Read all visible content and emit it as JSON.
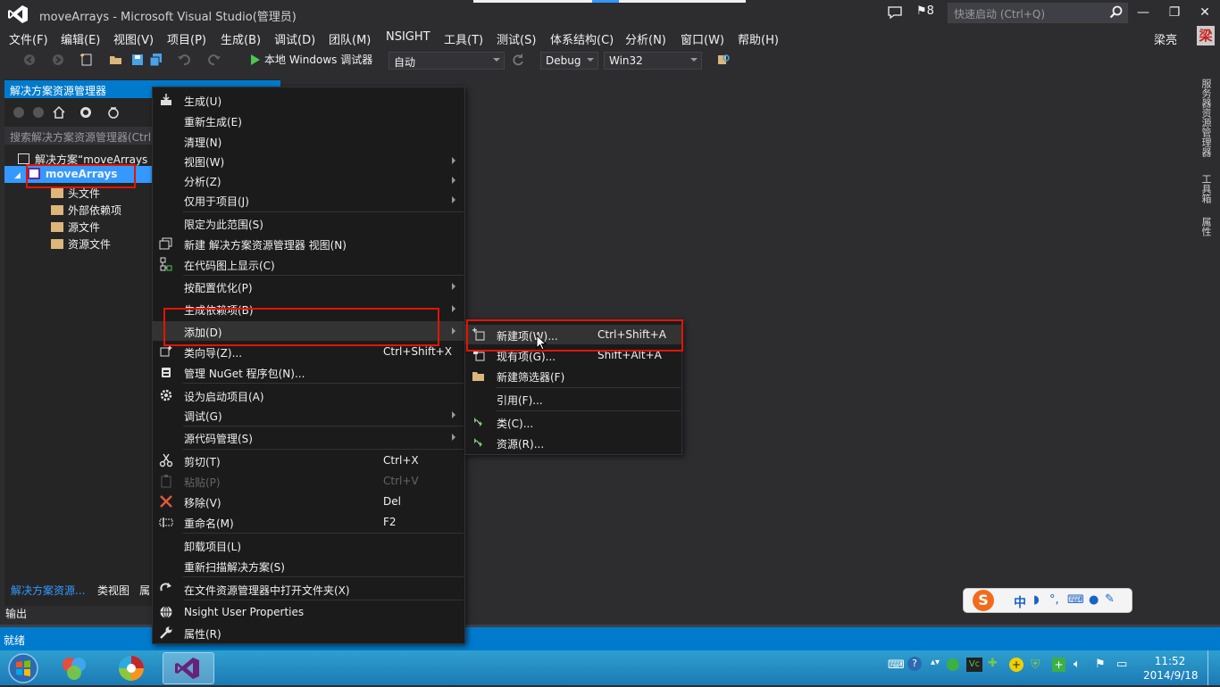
{
  "window": {
    "title": "moveArrays - Microsoft Visual Studio(管理员)",
    "notification_count": "8",
    "quick_launch_placeholder": "快速启动 (Ctrl+Q)",
    "user": "梁亮",
    "avatar": "梁"
  },
  "menubar": [
    "文件(F)",
    "编辑(E)",
    "视图(V)",
    "项目(P)",
    "生成(B)",
    "调试(D)",
    "团队(M)",
    "NSIGHT",
    "工具(T)",
    "测试(S)",
    "体系结构(C)",
    "分析(N)",
    "窗口(W)",
    "帮助(H)"
  ],
  "toolbar": {
    "start_debugger": "本地 Windows 调试器",
    "solution_config_mode": "自动",
    "configuration": "Debug",
    "platform": "Win32"
  },
  "solution_explorer": {
    "title": "解决方案资源管理器",
    "search_placeholder": "搜索解决方案资源管理器(Ctrl",
    "solution": "解决方案“moveArrays",
    "project": "moveArrays",
    "nodes": [
      "头文件",
      "外部依赖项",
      "源文件",
      "资源文件"
    ],
    "bottom_tabs": [
      "解决方案资源...",
      "类视图",
      "属"
    ]
  },
  "output_label": "输出",
  "status": "就绪",
  "right_tabs": [
    "服务器资源管理器",
    "工具箱",
    "属性"
  ],
  "context_menu": {
    "items": [
      {
        "label": "生成(U)",
        "shortcut": "",
        "submenu": false
      },
      {
        "label": "重新生成(E)",
        "shortcut": "",
        "submenu": false
      },
      {
        "label": "清理(N)",
        "shortcut": "",
        "submenu": false
      },
      {
        "label": "视图(W)",
        "shortcut": "",
        "submenu": true
      },
      {
        "label": "分析(Z)",
        "shortcut": "",
        "submenu": true
      },
      {
        "label": "仅用于项目(J)",
        "shortcut": "",
        "submenu": true
      },
      {
        "label": "限定为此范围(S)",
        "shortcut": "",
        "submenu": false
      },
      {
        "label": "新建 解决方案资源管理器 视图(N)",
        "shortcut": "",
        "submenu": false
      },
      {
        "label": "在代码图上显示(C)",
        "shortcut": "",
        "submenu": false
      },
      {
        "label": "按配置优化(P)",
        "shortcut": "",
        "submenu": true
      },
      {
        "label": "生成依赖项(B)",
        "shortcut": "",
        "submenu": true
      },
      {
        "label": "添加(D)",
        "shortcut": "",
        "submenu": true
      },
      {
        "label": "类向导(Z)...",
        "shortcut": "Ctrl+Shift+X",
        "submenu": false
      },
      {
        "label": "管理 NuGet 程序包(N)...",
        "shortcut": "",
        "submenu": false
      },
      {
        "label": "设为启动项目(A)",
        "shortcut": "",
        "submenu": false
      },
      {
        "label": "调试(G)",
        "shortcut": "",
        "submenu": true
      },
      {
        "label": "源代码管理(S)",
        "shortcut": "",
        "submenu": true
      },
      {
        "label": "剪切(T)",
        "shortcut": "Ctrl+X",
        "submenu": false
      },
      {
        "label": "粘贴(P)",
        "shortcut": "Ctrl+V",
        "submenu": false
      },
      {
        "label": "移除(V)",
        "shortcut": "Del",
        "submenu": false
      },
      {
        "label": "重命名(M)",
        "shortcut": "F2",
        "submenu": false
      },
      {
        "label": "卸载项目(L)",
        "shortcut": "",
        "submenu": false
      },
      {
        "label": "重新扫描解决方案(S)",
        "shortcut": "",
        "submenu": false
      },
      {
        "label": "在文件资源管理器中打开文件夹(X)",
        "shortcut": "",
        "submenu": false
      },
      {
        "label": "Nsight User Properties",
        "shortcut": "",
        "submenu": false
      },
      {
        "label": "属性(R)",
        "shortcut": "",
        "submenu": false
      }
    ]
  },
  "add_submenu": {
    "items": [
      {
        "label": "新建项(W)...",
        "shortcut": "Ctrl+Shift+A"
      },
      {
        "label": "现有项(G)...",
        "shortcut": "Shift+Alt+A"
      },
      {
        "label": "新建筛选器(F)",
        "shortcut": ""
      },
      {
        "label": "引用(F)...",
        "shortcut": ""
      },
      {
        "label": "类(C)...",
        "shortcut": ""
      },
      {
        "label": "资源(R)...",
        "shortcut": ""
      }
    ]
  },
  "ime": {
    "logo": "S",
    "mode": "中"
  },
  "clock": {
    "time": "11:52",
    "date": "2014/9/18"
  },
  "colors": {
    "accent": "#007acc",
    "selection": "#3399ff",
    "highlight_box": "#e51400",
    "background": "#2d2d30"
  }
}
